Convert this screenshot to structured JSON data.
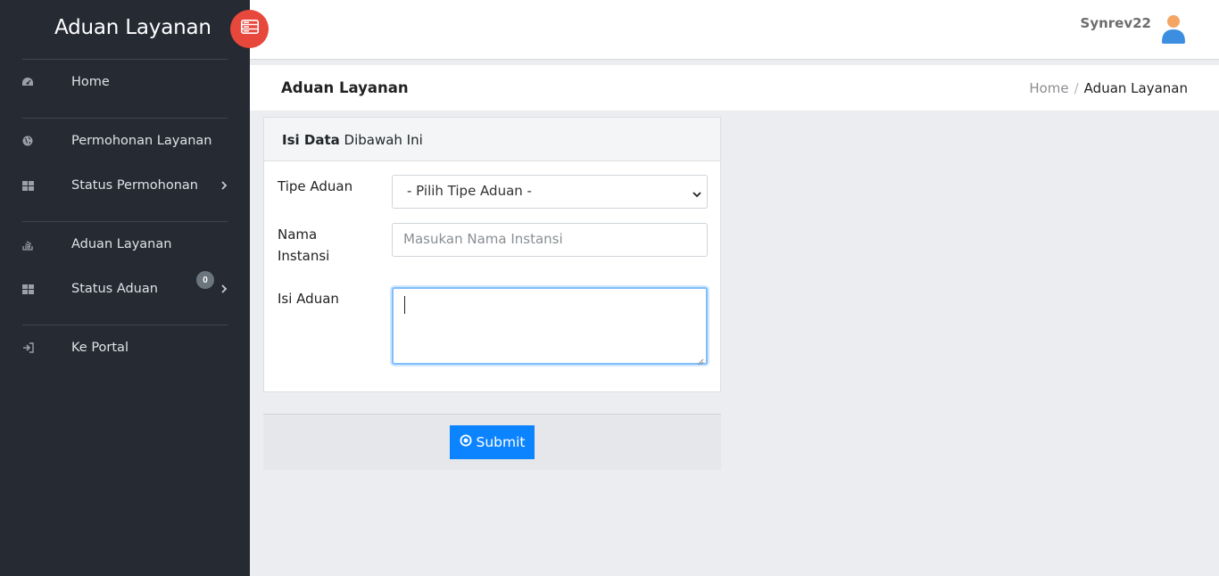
{
  "sidebar": {
    "brand": "Aduan Layanan",
    "items": [
      {
        "label": "Home",
        "icon": "dashboard-icon"
      },
      {
        "label": "Permohonan Layanan",
        "icon": "globe-icon"
      },
      {
        "label": "Status Permohonan",
        "icon": "grid-icon"
      },
      {
        "label": "Aduan Layanan",
        "icon": "stack-overflow-icon"
      },
      {
        "label": "Status Aduan",
        "icon": "grid-icon",
        "badge": "0"
      },
      {
        "label": "Ke Portal",
        "icon": "sign-in-icon"
      }
    ]
  },
  "header": {
    "username": "Synrev22"
  },
  "subheader": {
    "title": "Aduan Layanan",
    "breadcrumb": {
      "home": "Home",
      "separator": "/",
      "current": "Aduan Layanan"
    }
  },
  "form": {
    "header_bold": "Isi Data",
    "header_rest": " Dibawah Ini",
    "tipe_label": "Tipe Aduan",
    "tipe_selected": "- Pilih Tipe Aduan -",
    "nama_label_1": "Nama",
    "nama_label_2": "Instansi",
    "nama_placeholder": "Masukan Nama Instansi",
    "isi_label": "Isi Aduan",
    "submit_label": "Submit"
  },
  "colors": {
    "sidebar_bg": "#252a33",
    "toggle_bg": "#e8473b",
    "primary": "#0d84ff"
  }
}
